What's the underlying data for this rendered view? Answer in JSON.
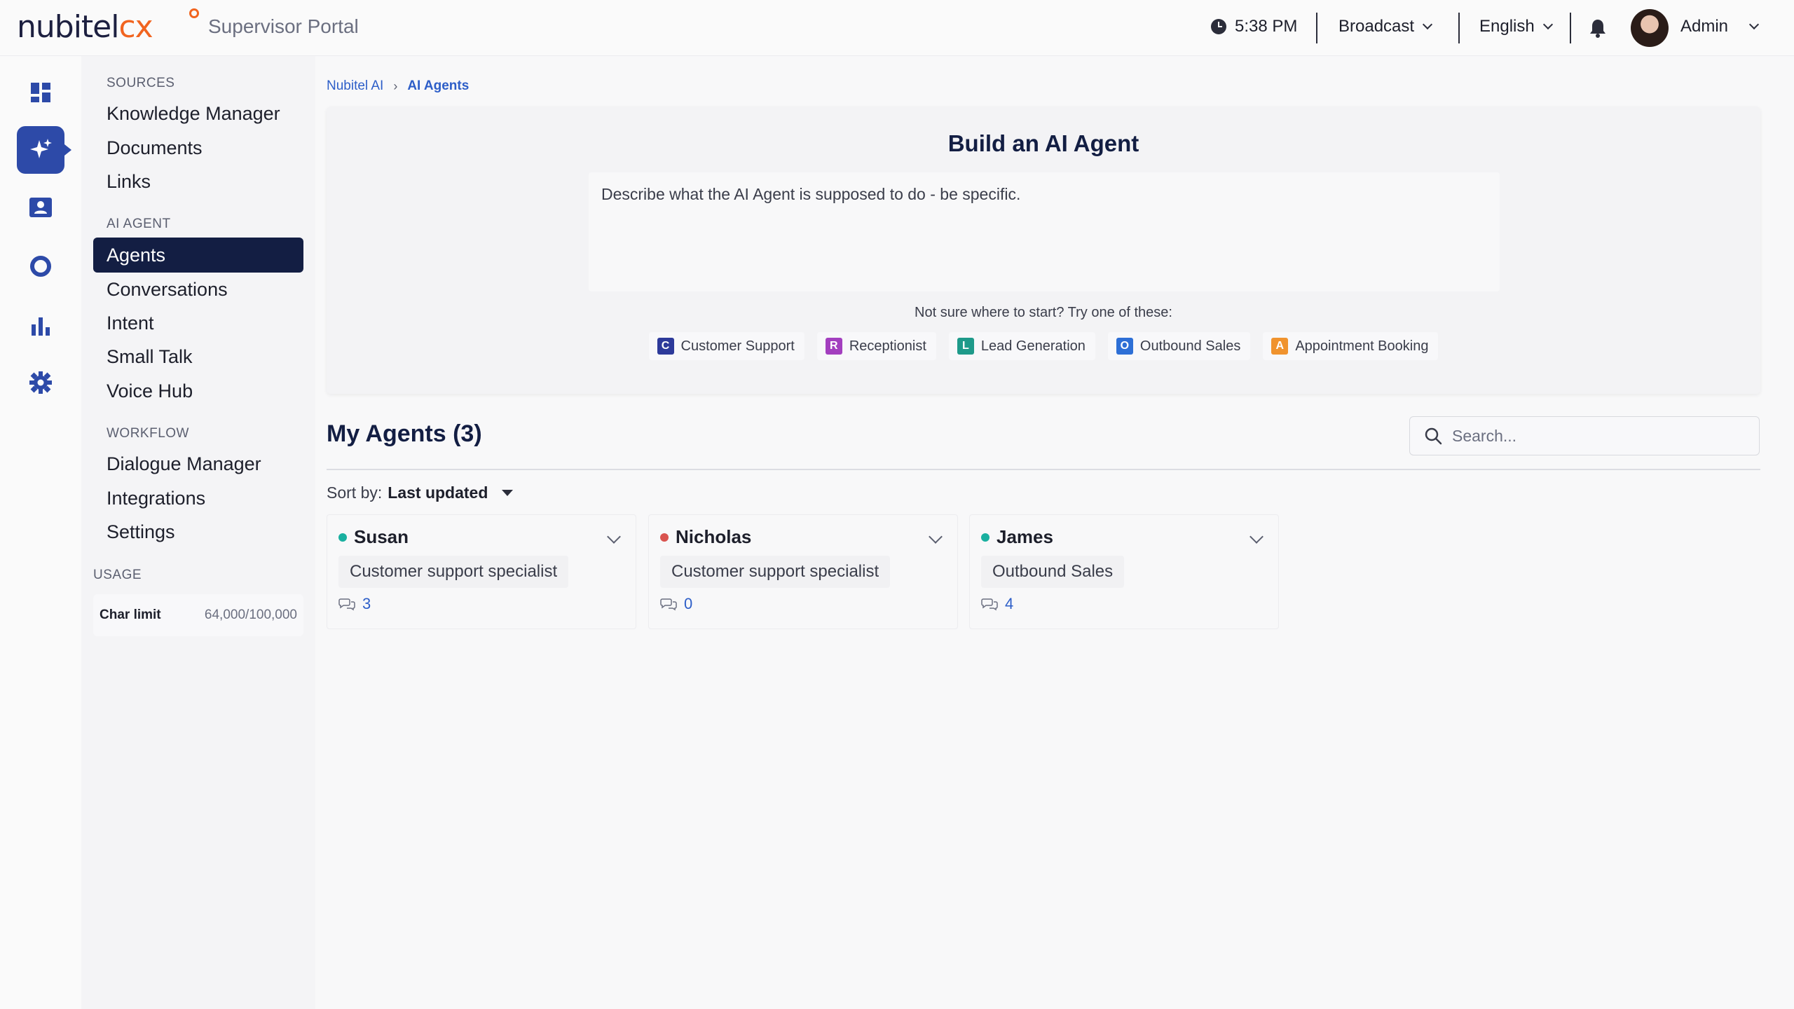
{
  "header": {
    "logo_part1": "nubitel",
    "logo_part2": "cx",
    "portal_title": "Supervisor Portal",
    "time": "5:38 PM",
    "broadcast": "Broadcast",
    "language": "English",
    "user": "Admin"
  },
  "rail": [
    "dashboard-icon",
    "ai-sparkle-icon",
    "contact-card-icon",
    "ring-icon",
    "bar-chart-icon",
    "settings-gear-icon"
  ],
  "sidebar": {
    "sources_heading": "SOURCES",
    "sources": [
      "Knowledge Manager",
      "Documents",
      "Links"
    ],
    "ai_agent_heading": "AI AGENT",
    "ai_agent": [
      "Agents",
      "Conversations",
      "Intent",
      "Small Talk",
      "Voice Hub"
    ],
    "workflow_heading": "WORKFLOW",
    "workflow": [
      "Dialogue Manager",
      "Integrations",
      "Settings"
    ],
    "usage_heading": "USAGE",
    "usage_label": "Char limit",
    "usage_value": "64,000/100,000"
  },
  "breadcrumb": {
    "root": "Nubitel AI",
    "current": "AI Agents"
  },
  "builder": {
    "title": "Build an AI Agent",
    "placeholder": "Describe what the AI Agent is supposed to do - be specific.",
    "hint": "Not sure where to start? Try one of these:",
    "templates": [
      {
        "letter": "C",
        "label": "Customer Support",
        "color": "#2d3a9a"
      },
      {
        "letter": "R",
        "label": "Receptionist",
        "color": "#a33fbf"
      },
      {
        "letter": "L",
        "label": "Lead Generation",
        "color": "#1e9a8a"
      },
      {
        "letter": "O",
        "label": "Outbound Sales",
        "color": "#2d6fd6"
      },
      {
        "letter": "A",
        "label": "Appointment Booking",
        "color": "#f0932e"
      }
    ]
  },
  "agents": {
    "title": "My Agents (3)",
    "search_placeholder": "Search...",
    "sort_label": "Sort by:",
    "sort_value": "Last updated",
    "list": [
      {
        "name": "Susan",
        "role": "Customer support specialist",
        "count": "3",
        "status_color": "#1ab0a0"
      },
      {
        "name": "Nicholas",
        "role": "Customer support specialist",
        "count": "0",
        "status_color": "#d9534f"
      },
      {
        "name": "James",
        "role": "Outbound Sales",
        "count": "4",
        "status_color": "#1ab0a0"
      }
    ]
  }
}
